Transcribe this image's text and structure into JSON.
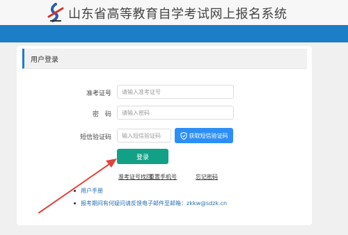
{
  "header": {
    "title": "山东省高等教育自学考试网上报名系统"
  },
  "login": {
    "panel_title": "用户登录",
    "exam_id_label": "准考证号",
    "exam_id_placeholder": "请输入准考证号",
    "password_label": "密　码",
    "password_placeholder": "请输入密码",
    "sms_label": "短信验证码",
    "sms_placeholder": "输入短信验证码",
    "sms_button": "获取短信验证码",
    "submit": "登录"
  },
  "links": {
    "recover_exam_id": "准考证号找回",
    "reset_phone": "重置手机号",
    "forgot_password": "忘记密码"
  },
  "notes": {
    "manual": "用户手册",
    "contact": "报考期间有何疑问请反馈电子邮件至邮箱：zkkw@sdzk.cn"
  },
  "colors": {
    "brand_blue": "#1b7ec6",
    "login_green": "#12a086",
    "sms_blue": "#2d8ff5",
    "annotation_red": "#e0433a"
  }
}
